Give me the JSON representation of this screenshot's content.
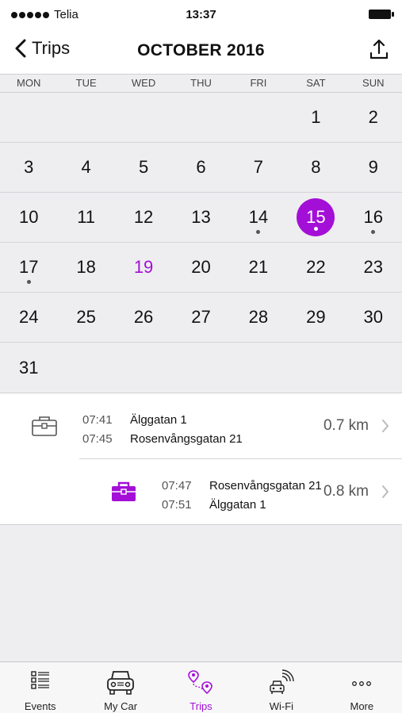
{
  "status_bar": {
    "carrier": "Telia",
    "time": "13:37"
  },
  "nav": {
    "back_label": "Trips",
    "title": "OCTOBER 2016"
  },
  "weekdays": [
    "MON",
    "TUE",
    "WED",
    "THU",
    "FRI",
    "SAT",
    "SUN"
  ],
  "calendar": {
    "weeks": [
      [
        "",
        "",
        "",
        "",
        "",
        "1",
        "2"
      ],
      [
        "3",
        "4",
        "5",
        "6",
        "7",
        "8",
        "9"
      ],
      [
        "10",
        "11",
        "12",
        "13",
        "14",
        "15",
        "16"
      ],
      [
        "17",
        "18",
        "19",
        "20",
        "21",
        "22",
        "23"
      ],
      [
        "24",
        "25",
        "26",
        "27",
        "28",
        "29",
        "30"
      ],
      [
        "31",
        "",
        "",
        "",
        "",
        "",
        ""
      ]
    ],
    "selected_day": "15",
    "today": "19",
    "days_with_trips": [
      "14",
      "15",
      "16",
      "17"
    ],
    "accent_color": "#a40fd7"
  },
  "trips": [
    {
      "icon": "briefcase-outline-icon",
      "start_time": "07:41",
      "end_time": "07:45",
      "from": "Älggatan 1",
      "to": "Rosenvångsgatan 21",
      "distance": "0.7 km"
    },
    {
      "icon": "briefcase-filled-icon",
      "start_time": "07:47",
      "end_time": "07:51",
      "from": "Rosenvångsgatan 21",
      "to": "Älggatan 1",
      "distance": "0.8 km"
    }
  ],
  "tabs": [
    {
      "label": "Events",
      "icon": "list-icon",
      "active": false
    },
    {
      "label": "My Car",
      "icon": "car-icon",
      "active": false
    },
    {
      "label": "Trips",
      "icon": "route-icon",
      "active": true
    },
    {
      "label": "Wi-Fi",
      "icon": "car-wifi-icon",
      "active": false
    },
    {
      "label": "More",
      "icon": "more-dots-icon",
      "active": false
    }
  ]
}
